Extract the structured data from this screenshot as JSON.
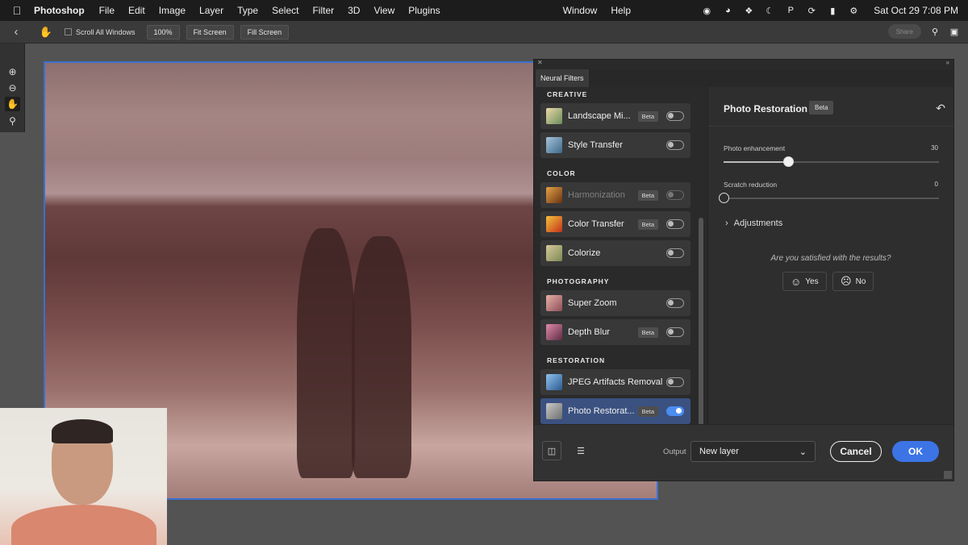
{
  "menubar": {
    "app": "Photoshop",
    "items": [
      "File",
      "Edit",
      "Image",
      "Layer",
      "Type",
      "Select",
      "Filter",
      "3D",
      "View",
      "Plugins"
    ],
    "right_items": [
      "Window",
      "Help"
    ],
    "clock": "Sat Oct 29  7:08 PM"
  },
  "optionsbar": {
    "scroll_all_windows": "Scroll All Windows",
    "zoom_100": "100%",
    "fit_screen": "Fit Screen",
    "fill_screen": "Fill Screen",
    "share": "Share"
  },
  "neural_filters": {
    "tab": "Neural Filters",
    "sections": {
      "creative": "CREATIVE",
      "color": "COLOR",
      "photography": "PHOTOGRAPHY",
      "restoration": "RESTORATION"
    },
    "filters": [
      {
        "name": "Landscape Mi...",
        "beta": "Beta",
        "on": false
      },
      {
        "name": "Style Transfer",
        "beta": "",
        "on": false
      },
      {
        "name": "Harmonization",
        "beta": "Beta",
        "on": false
      },
      {
        "name": "Color Transfer",
        "beta": "Beta",
        "on": false
      },
      {
        "name": "Colorize",
        "beta": "",
        "on": false
      },
      {
        "name": "Super Zoom",
        "beta": "",
        "on": false
      },
      {
        "name": "Depth Blur",
        "beta": "Beta",
        "on": false
      },
      {
        "name": "JPEG Artifacts Removal",
        "beta": "",
        "on": false
      },
      {
        "name": "Photo Restorat...",
        "beta": "Beta",
        "on": true
      }
    ],
    "detail": {
      "title": "Photo Restoration",
      "beta": "Beta",
      "photo_enhancement_label": "Photo enhancement",
      "photo_enhancement_value": "30",
      "photo_enhancement_fraction": 0.3,
      "scratch_reduction_label": "Scratch reduction",
      "scratch_reduction_value": "0",
      "scratch_reduction_fraction": 0,
      "adjustments": "Adjustments",
      "satisfied_question": "Are you satisfied with the results?",
      "yes": "Yes",
      "no": "No"
    },
    "bottom": {
      "output_label": "Output",
      "output_value": "New layer",
      "cancel": "Cancel",
      "ok": "OK"
    }
  }
}
